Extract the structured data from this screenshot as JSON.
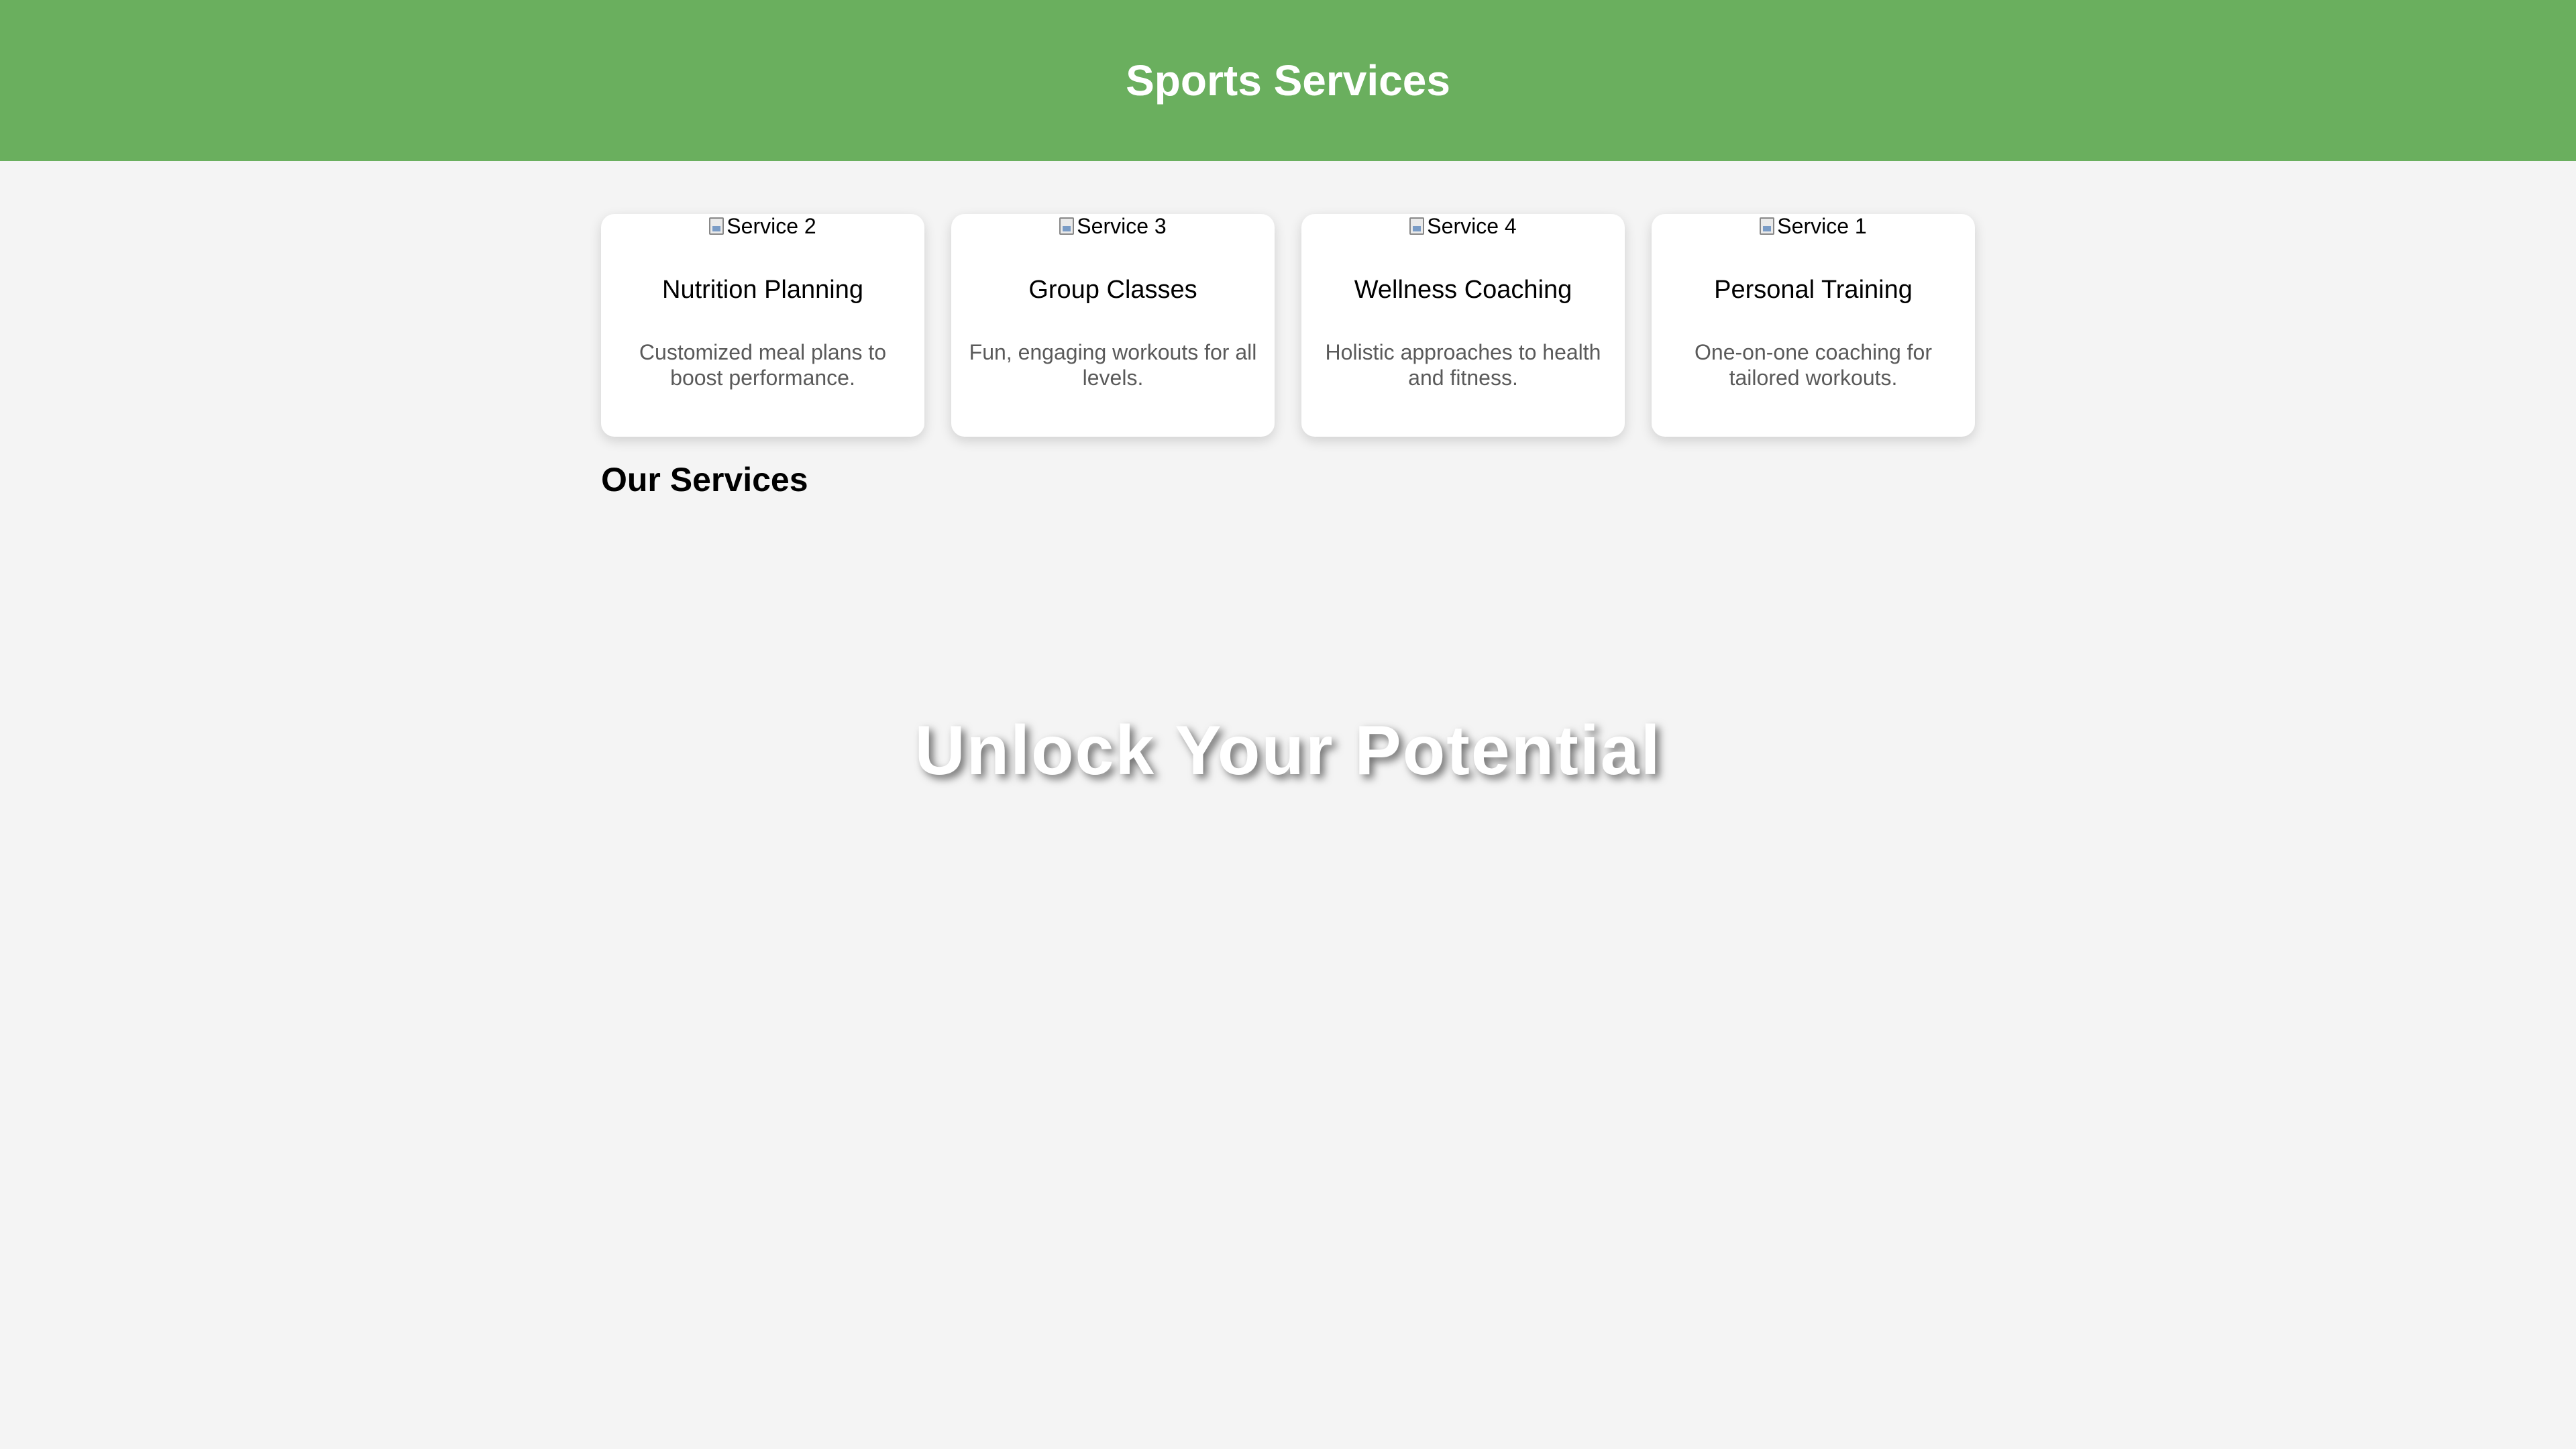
{
  "header": {
    "title": "Sports Services",
    "background_color": "#6aaf5e"
  },
  "services": [
    {
      "image_alt": "Service 2",
      "title": "Nutrition Planning",
      "description": "Customized meal plans to boost performance."
    },
    {
      "image_alt": "Service 3",
      "title": "Group Classes",
      "description": "Fun, engaging workouts for all levels."
    },
    {
      "image_alt": "Service 4",
      "title": "Wellness Coaching",
      "description": "Holistic approaches to health and fitness."
    },
    {
      "image_alt": "Service 1",
      "title": "Personal Training",
      "description": "One-on-one coaching for tailored workouts."
    }
  ],
  "section": {
    "title": "Our Services"
  },
  "hero": {
    "headline": "Unlock Your Potential"
  },
  "icons": {
    "service_image": "broken-image-icon"
  }
}
